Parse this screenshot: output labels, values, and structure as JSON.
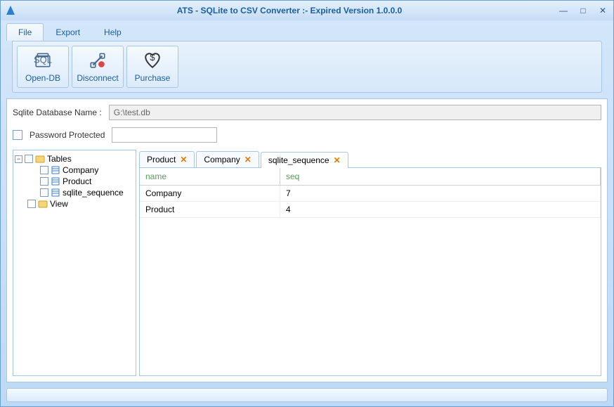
{
  "window": {
    "title": "ATS - SQLite to CSV Converter :- Expired Version 1.0.0.0"
  },
  "menu": {
    "file": "File",
    "export": "Export",
    "help": "Help"
  },
  "ribbon": {
    "open_db": "Open-DB",
    "disconnect": "Disconnect",
    "purchase": "Purchase"
  },
  "form": {
    "db_label": "Sqlite Database Name :",
    "db_value": "G:\\test.db",
    "pw_label": "Password Protected"
  },
  "tree": {
    "tables": "Tables",
    "items": [
      {
        "label": "Company"
      },
      {
        "label": "Product"
      },
      {
        "label": "sqlite_sequence"
      }
    ],
    "view": "View"
  },
  "tabs": [
    {
      "label": "Product",
      "active": false
    },
    {
      "label": "Company",
      "active": false
    },
    {
      "label": "sqlite_sequence",
      "active": true
    }
  ],
  "grid": {
    "columns": [
      "name",
      "seq"
    ],
    "rows": [
      {
        "name": "Company",
        "seq": "7"
      },
      {
        "name": "Product",
        "seq": "4"
      }
    ]
  }
}
